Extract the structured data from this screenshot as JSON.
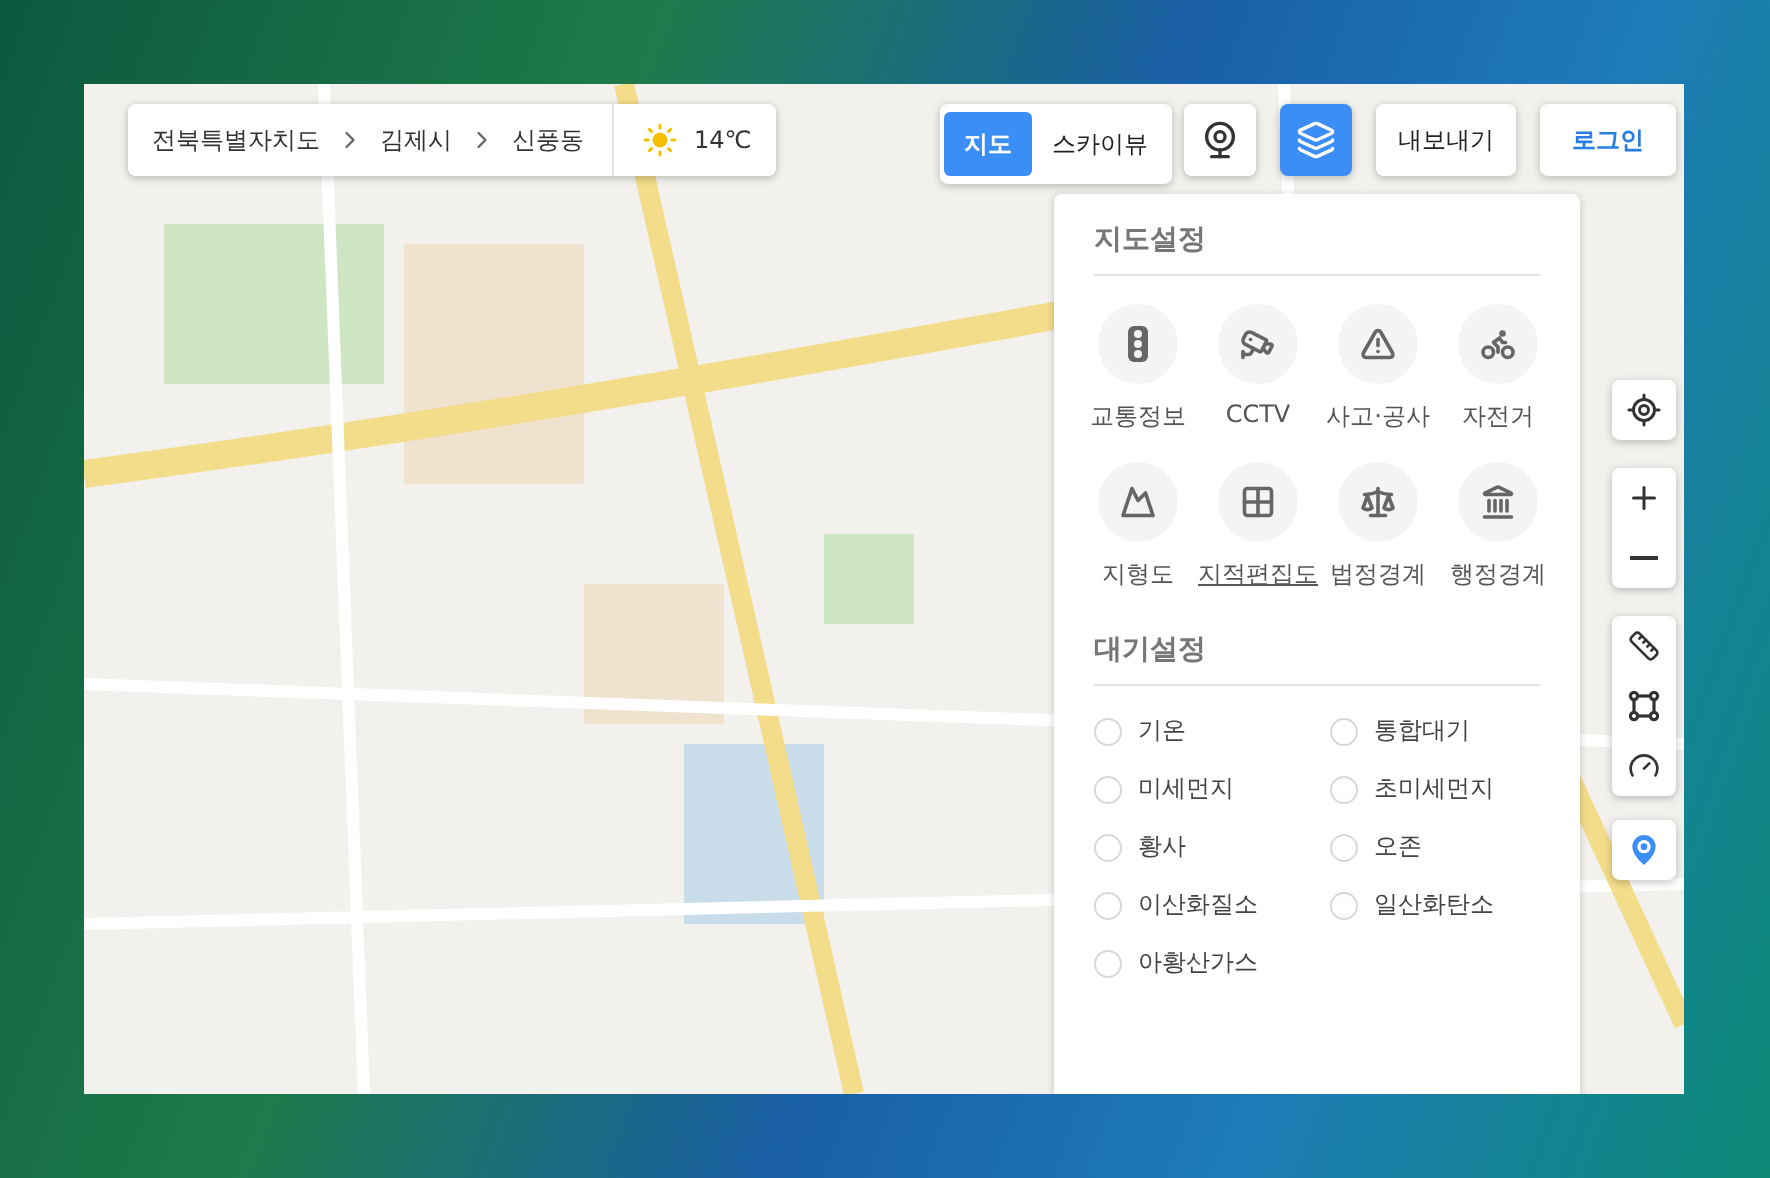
{
  "breadcrumb": {
    "items": [
      "전북특별자치도",
      "김제시",
      "신풍동"
    ],
    "weather": "14℃"
  },
  "map_types": [
    {
      "label": "지도",
      "selected": true
    },
    {
      "label": "스카이뷰",
      "selected": false
    }
  ],
  "street_view": {
    "selected": false
  },
  "layers": {
    "selected": true
  },
  "export_button": "내보내기",
  "login_button": "로그인",
  "map_settings": {
    "title": "지도설정",
    "items": [
      {
        "kind": "traffic",
        "label": "교통정보",
        "selected": false
      },
      {
        "kind": "cctv",
        "label": "CCTV",
        "selected": false
      },
      {
        "kind": "accident",
        "label": "사고·공사",
        "selected": false
      },
      {
        "kind": "bike",
        "label": "자전거",
        "selected": false
      },
      {
        "kind": "terrain",
        "label": "지형도",
        "selected": false
      },
      {
        "kind": "cadastral",
        "label": "지적편집도",
        "selected": true
      },
      {
        "kind": "legal",
        "label": "법정경계",
        "selected": false
      },
      {
        "kind": "admin",
        "label": "행정경계",
        "selected": false
      }
    ]
  },
  "air_settings": {
    "title": "대기설정",
    "items": [
      {
        "label": "기온",
        "selected": false
      },
      {
        "label": "통합대기",
        "selected": false
      },
      {
        "label": "미세먼지",
        "selected": false
      },
      {
        "label": "초미세먼지",
        "selected": false
      },
      {
        "label": "황사",
        "selected": false
      },
      {
        "label": "오존",
        "selected": false
      },
      {
        "label": "이산화질소",
        "selected": false
      },
      {
        "label": "일산화탄소",
        "selected": false
      },
      {
        "label": "아황산가스",
        "selected": false
      }
    ]
  }
}
